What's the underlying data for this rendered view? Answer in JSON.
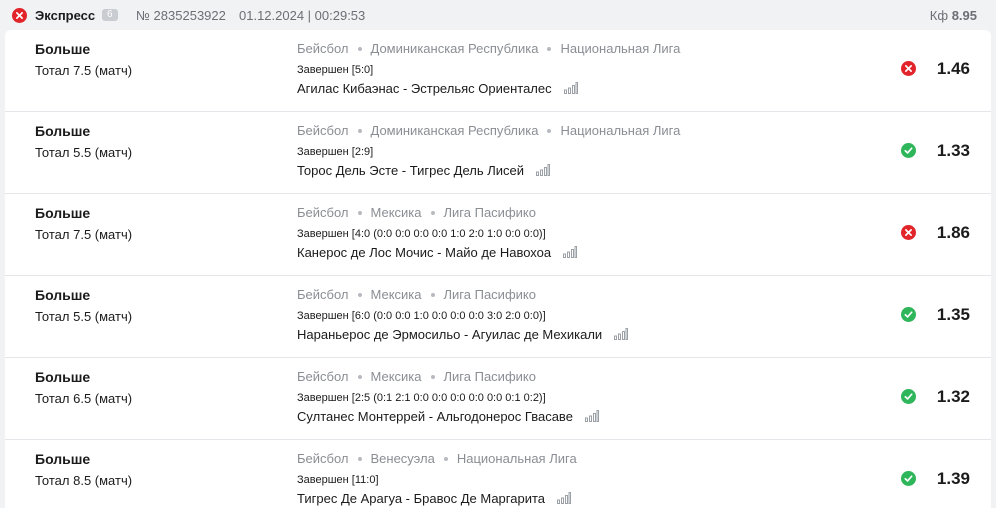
{
  "header": {
    "title": "Экспресс",
    "badge": "6",
    "number": "№ 2835253922",
    "datetime": "01.12.2024 | 00:29:53",
    "coef_label": "Кф",
    "coef_value": "8.95",
    "status_icon": "close-circle-icon"
  },
  "colors": {
    "lost": "#e2252b",
    "won": "#2fb65b",
    "muted": "#8a8e94"
  },
  "bets": [
    {
      "type": "Больше",
      "line": "Тотал 7.5 (матч)",
      "sport": "Бейсбол",
      "country": "Доминиканская Республика",
      "league": "Национальная Лига",
      "status": "Завершен [5:0]",
      "match": "Агилас Кибаэнас - Эстрельяс Ориенталес",
      "result": "lost",
      "odds": "1.46"
    },
    {
      "type": "Больше",
      "line": "Тотал 5.5 (матч)",
      "sport": "Бейсбол",
      "country": "Доминиканская Республика",
      "league": "Национальная Лига",
      "status": "Завершен [2:9]",
      "match": "Торос Дель Эсте - Тигрес Дель Лисей",
      "result": "won",
      "odds": "1.33"
    },
    {
      "type": "Больше",
      "line": "Тотал 7.5 (матч)",
      "sport": "Бейсбол",
      "country": "Мексика",
      "league": "Лига Пасифико",
      "status": "Завершен [4:0 (0:0 0:0 0:0 0:0 1:0 2:0 1:0 0:0 0:0)]",
      "match": "Канерос де Лос Мочис - Майо де Навохоа",
      "result": "lost",
      "odds": "1.86"
    },
    {
      "type": "Больше",
      "line": "Тотал 5.5 (матч)",
      "sport": "Бейсбол",
      "country": "Мексика",
      "league": "Лига Пасифико",
      "status": "Завершен [6:0 (0:0 0:0 1:0 0:0 0:0 0:0 3:0 2:0 0:0)]",
      "match": "Нараньерос де Эрмосильо - Агуилас де Мехикали",
      "result": "won",
      "odds": "1.35"
    },
    {
      "type": "Больше",
      "line": "Тотал 6.5 (матч)",
      "sport": "Бейсбол",
      "country": "Мексика",
      "league": "Лига Пасифико",
      "status": "Завершен [2:5 (0:1 2:1 0:0 0:0 0:0 0:0 0:0 0:1 0:2)]",
      "match": "Султанес Монтеррей - Альгодонерос Гвасаве",
      "result": "won",
      "odds": "1.32"
    },
    {
      "type": "Больше",
      "line": "Тотал 8.5 (матч)",
      "sport": "Бейсбол",
      "country": "Венесуэла",
      "league": "Национальная Лига",
      "status": "Завершен [11:0]",
      "match": "Тигрес Де Арагуа - Бравос Де Маргарита",
      "result": "won",
      "odds": "1.39"
    }
  ]
}
